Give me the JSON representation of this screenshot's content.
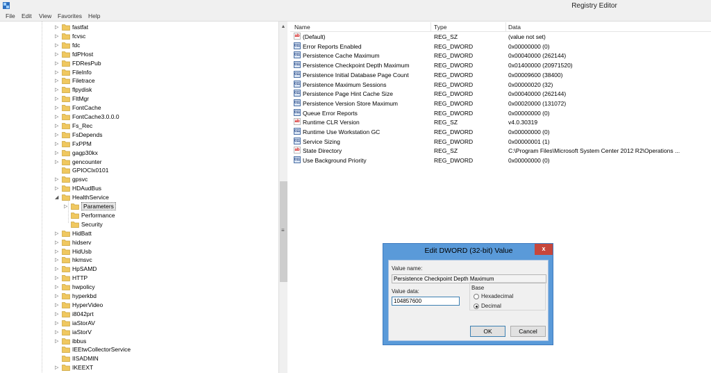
{
  "window": {
    "title": "Registry Editor"
  },
  "menu": [
    "File",
    "Edit",
    "View",
    "Favorites",
    "Help"
  ],
  "tree": [
    {
      "label": "fastfat",
      "depth": 0,
      "expandable": true
    },
    {
      "label": "fcvsc",
      "depth": 0,
      "expandable": true
    },
    {
      "label": "fdc",
      "depth": 0,
      "expandable": true
    },
    {
      "label": "fdPHost",
      "depth": 0,
      "expandable": true
    },
    {
      "label": "FDResPub",
      "depth": 0,
      "expandable": true
    },
    {
      "label": "FileInfo",
      "depth": 0,
      "expandable": true
    },
    {
      "label": "Filetrace",
      "depth": 0,
      "expandable": true
    },
    {
      "label": "flpydisk",
      "depth": 0,
      "expandable": true
    },
    {
      "label": "FltMgr",
      "depth": 0,
      "expandable": true
    },
    {
      "label": "FontCache",
      "depth": 0,
      "expandable": true
    },
    {
      "label": "FontCache3.0.0.0",
      "depth": 0,
      "expandable": true
    },
    {
      "label": "Fs_Rec",
      "depth": 0,
      "expandable": true
    },
    {
      "label": "FsDepends",
      "depth": 0,
      "expandable": true
    },
    {
      "label": "FxPPM",
      "depth": 0,
      "expandable": true
    },
    {
      "label": "gagp30kx",
      "depth": 0,
      "expandable": true
    },
    {
      "label": "gencounter",
      "depth": 0,
      "expandable": true
    },
    {
      "label": "GPIOClx0101",
      "depth": 0,
      "expandable": false
    },
    {
      "label": "gpsvc",
      "depth": 0,
      "expandable": true
    },
    {
      "label": "HDAudBus",
      "depth": 0,
      "expandable": true
    },
    {
      "label": "HealthService",
      "depth": 0,
      "expandable": true,
      "expanded": true
    },
    {
      "label": "Parameters",
      "depth": 1,
      "expandable": true,
      "selected": true
    },
    {
      "label": "Performance",
      "depth": 1,
      "expandable": false
    },
    {
      "label": "Security",
      "depth": 1,
      "expandable": false
    },
    {
      "label": "HidBatt",
      "depth": 0,
      "expandable": true
    },
    {
      "label": "hidserv",
      "depth": 0,
      "expandable": true
    },
    {
      "label": "HidUsb",
      "depth": 0,
      "expandable": true
    },
    {
      "label": "hkmsvc",
      "depth": 0,
      "expandable": true
    },
    {
      "label": "HpSAMD",
      "depth": 0,
      "expandable": true
    },
    {
      "label": "HTTP",
      "depth": 0,
      "expandable": true
    },
    {
      "label": "hwpolicy",
      "depth": 0,
      "expandable": true
    },
    {
      "label": "hyperkbd",
      "depth": 0,
      "expandable": true
    },
    {
      "label": "HyperVideo",
      "depth": 0,
      "expandable": true
    },
    {
      "label": "i8042prt",
      "depth": 0,
      "expandable": true
    },
    {
      "label": "iaStorAV",
      "depth": 0,
      "expandable": true
    },
    {
      "label": "iaStorV",
      "depth": 0,
      "expandable": true
    },
    {
      "label": "ibbus",
      "depth": 0,
      "expandable": true
    },
    {
      "label": "IEEtwCollectorService",
      "depth": 0,
      "expandable": false
    },
    {
      "label": "IISADMIN",
      "depth": 0,
      "expandable": false
    },
    {
      "label": "IKEEXT",
      "depth": 0,
      "expandable": true
    }
  ],
  "list": {
    "columns": [
      "Name",
      "Type",
      "Data"
    ],
    "rows": [
      {
        "name": "(Default)",
        "type": "REG_SZ",
        "data": "(value not set)",
        "icon": "string-value-icon"
      },
      {
        "name": "Error Reports Enabled",
        "type": "REG_DWORD",
        "data": "0x00000000 (0)",
        "icon": "dword-value-icon"
      },
      {
        "name": "Persistence Cache Maximum",
        "type": "REG_DWORD",
        "data": "0x00040000 (262144)",
        "icon": "dword-value-icon"
      },
      {
        "name": "Persistence Checkpoint Depth Maximum",
        "type": "REG_DWORD",
        "data": "0x01400000 (20971520)",
        "icon": "dword-value-icon"
      },
      {
        "name": "Persistence Initial Database Page Count",
        "type": "REG_DWORD",
        "data": "0x00009600 (38400)",
        "icon": "dword-value-icon"
      },
      {
        "name": "Persistence Maximum Sessions",
        "type": "REG_DWORD",
        "data": "0x00000020 (32)",
        "icon": "dword-value-icon"
      },
      {
        "name": "Persistence Page Hint Cache Size",
        "type": "REG_DWORD",
        "data": "0x00040000 (262144)",
        "icon": "dword-value-icon"
      },
      {
        "name": "Persistence Version Store Maximum",
        "type": "REG_DWORD",
        "data": "0x00020000 (131072)",
        "icon": "dword-value-icon"
      },
      {
        "name": "Queue Error Reports",
        "type": "REG_DWORD",
        "data": "0x00000000 (0)",
        "icon": "dword-value-icon"
      },
      {
        "name": "Runtime CLR Version",
        "type": "REG_SZ",
        "data": "v4.0.30319",
        "icon": "string-value-icon"
      },
      {
        "name": "Runtime Use Workstation GC",
        "type": "REG_DWORD",
        "data": "0x00000000 (0)",
        "icon": "dword-value-icon"
      },
      {
        "name": "Service Sizing",
        "type": "REG_DWORD",
        "data": "0x00000001 (1)",
        "icon": "dword-value-icon"
      },
      {
        "name": "State Directory",
        "type": "REG_SZ",
        "data": "C:\\Program Files\\Microsoft System Center 2012 R2\\Operations ...",
        "icon": "string-value-icon"
      },
      {
        "name": "Use Background Priority",
        "type": "REG_DWORD",
        "data": "0x00000000 (0)",
        "icon": "dword-value-icon"
      }
    ]
  },
  "dialog": {
    "title": "Edit DWORD (32-bit) Value",
    "close": "x",
    "value_name_label": "Value name:",
    "value_name": "Persistence Checkpoint Depth Maximum",
    "value_data_label": "Value data:",
    "value_data": "104857600",
    "base_label": "Base",
    "hex_label": "Hexadecimal",
    "dec_label": "Decimal",
    "selected_base": "Decimal",
    "ok_label": "OK",
    "cancel_label": "Cancel"
  },
  "colors": {
    "dialog_frame": "#5a9ad9",
    "close_button": "#c7463b",
    "folder": "#f0c860"
  }
}
